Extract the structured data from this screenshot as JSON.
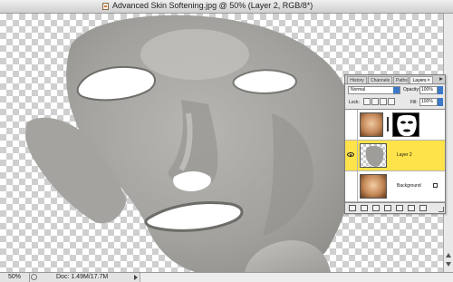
{
  "window": {
    "title": "Advanced Skin Softening.jpg @ 50% (Layer 2, RGB/8*)"
  },
  "statusbar": {
    "zoom": "50%",
    "doc_size": "Doc: 1.49M/17.7M"
  },
  "palette": {
    "tabs": [
      {
        "label": "History",
        "active": false
      },
      {
        "label": "Channels",
        "active": false
      },
      {
        "label": "Paths",
        "active": false
      },
      {
        "label": "Layers",
        "active": true
      }
    ],
    "blend_mode": "Normal",
    "opacity_label": "Opacity:",
    "opacity": "100%",
    "lock_label": "Lock:",
    "fill_label": "Fill:",
    "fill": "100%",
    "layers": [
      {
        "name": "",
        "visible": false,
        "has_mask": true
      },
      {
        "name": "Layer 2",
        "visible": true,
        "selected": true
      },
      {
        "name": "Background",
        "visible": false,
        "locked": true
      }
    ],
    "footer_icons": [
      "link-layers-icon",
      "layer-style-icon",
      "add-mask-icon",
      "adjustment-layer-icon",
      "new-group-icon",
      "new-layer-icon",
      "trash-icon"
    ]
  },
  "colors": {
    "selection_highlight": "#ffe34a",
    "dropdown_accent": "#3b78c8"
  }
}
